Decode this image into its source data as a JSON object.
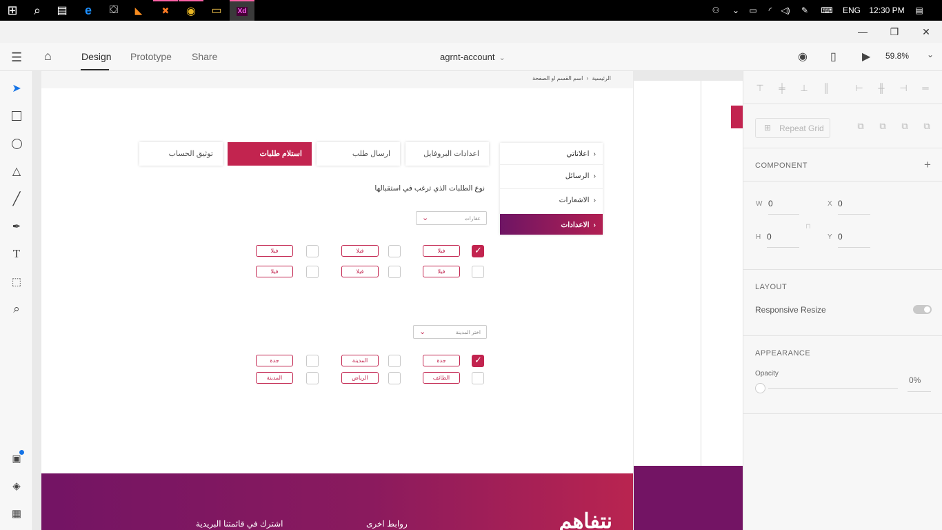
{
  "taskbar": {
    "clock": "12:30 PM",
    "language": "ENG",
    "apps": [
      {
        "name": "start-icon",
        "glyph": "⊞"
      },
      {
        "name": "search-icon",
        "glyph": "⌕"
      },
      {
        "name": "task-view-icon",
        "glyph": "▤"
      },
      {
        "name": "edge-icon",
        "glyph": "e"
      },
      {
        "name": "store-icon",
        "glyph": "⛋"
      },
      {
        "name": "vlc-icon",
        "glyph": "◣"
      },
      {
        "name": "xampp-icon",
        "glyph": "✖"
      },
      {
        "name": "chrome-icon",
        "glyph": "◉"
      },
      {
        "name": "file-explorer-icon",
        "glyph": "▭"
      },
      {
        "name": "adobe-xd-icon",
        "glyph": "Xd"
      }
    ]
  },
  "window": {
    "minimize": "—",
    "maximize": "❐",
    "close": "✕"
  },
  "appbar": {
    "tabs": [
      "Design",
      "Prototype",
      "Share"
    ],
    "document_title": "agrnt-account",
    "zoom": "59.8%"
  },
  "artboard": {
    "breadcrumb_home": "الرئيسية",
    "breadcrumb_sep": "‹",
    "breadcrumb_current": "اسم القسم او الصفحة",
    "tabs": [
      "اعدادات البروفايل",
      "ارسال طلب",
      "استلام طلبات",
      "توثيق الحساب"
    ],
    "side_menu": [
      "اعلاناتي",
      "الرسائل",
      "الاشعارات",
      "الاعدادات"
    ],
    "question": "نوع الطلبات الذي ترغب في استقبالها",
    "type_dropdown": "عقارات",
    "type_chips": [
      "فيلا",
      "فيلا",
      "فيلا",
      "فيلا",
      "فيلا",
      "فيلا"
    ],
    "type_checks": [
      true,
      false,
      false,
      false,
      false,
      false
    ],
    "city_dropdown": "اختر المدينة",
    "city_chips": [
      "جدة",
      "المدينة",
      "جدة",
      "الطائف",
      "الرياض",
      "المدينة"
    ],
    "city_checks": [
      true,
      false,
      false,
      false,
      false,
      false
    ],
    "footer": {
      "logo": "نتفاهم",
      "links_title": "روابط اخرى",
      "newsletter_title": "اشترك في قائمتنا البريدية"
    }
  },
  "props": {
    "repeat_grid": "Repeat Grid",
    "component": "COMPONENT",
    "w_label": "W",
    "w": "0",
    "x_label": "X",
    "x": "0",
    "h_label": "H",
    "h": "0",
    "y_label": "Y",
    "y": "0",
    "layout": "LAYOUT",
    "responsive": "Responsive Resize",
    "appearance": "APPEARANCE",
    "opacity_label": "Opacity",
    "opacity": "0%"
  },
  "colors": {
    "accent": "#c2244f",
    "purple": "#731464"
  }
}
